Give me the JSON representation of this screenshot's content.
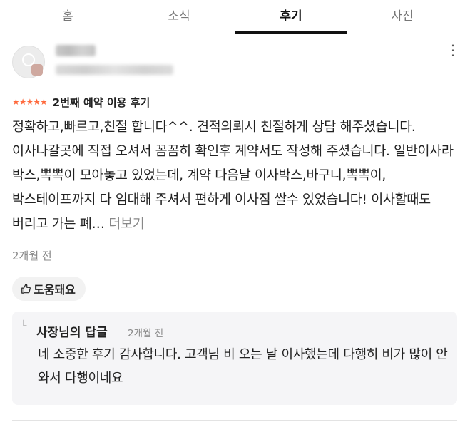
{
  "tabs": [
    {
      "label": "홈",
      "active": false
    },
    {
      "label": "소식",
      "active": false
    },
    {
      "label": "후기",
      "active": true
    },
    {
      "label": "사진",
      "active": false
    }
  ],
  "review": {
    "rating_stars": "★★★★★",
    "visit_note": "2번째 예약 이용 후기",
    "text": "정확하고,빠르고,친절 합니다^^. 견적의뢰시 친절하게 상담 해주셨습니다. 이사나갈곳에 직접 오셔서 꼼꼼히 확인후 계약서도 작성해 주셨습니다. 일반이사라 박스,뽁뽁이 모아놓고 있었는데, 계약 다음날 이사박스,바구니,뽁뽁이,박스테이프까지 다 임대해 주셔서 편하게 이사짐 쌀수 있었습니다! 이사할때도 버리고 가는 폐…",
    "more_label": "더보기",
    "date": "2개월 전",
    "helpful_label": "도움돼요",
    "menu_icon": "⋮"
  },
  "reply": {
    "arrow": "└",
    "title": "사장님의 답글",
    "date": "2개월 전",
    "text": "네 소중한 후기 감사합니다. 고객님 비 오는 날 이사했는데 다행히 비가 많이 안 와서 다행이네요"
  },
  "colors": {
    "star": "#ff6a3d",
    "reply_bg": "#f5f5f7",
    "helpful_bg": "#f2f2f2"
  }
}
